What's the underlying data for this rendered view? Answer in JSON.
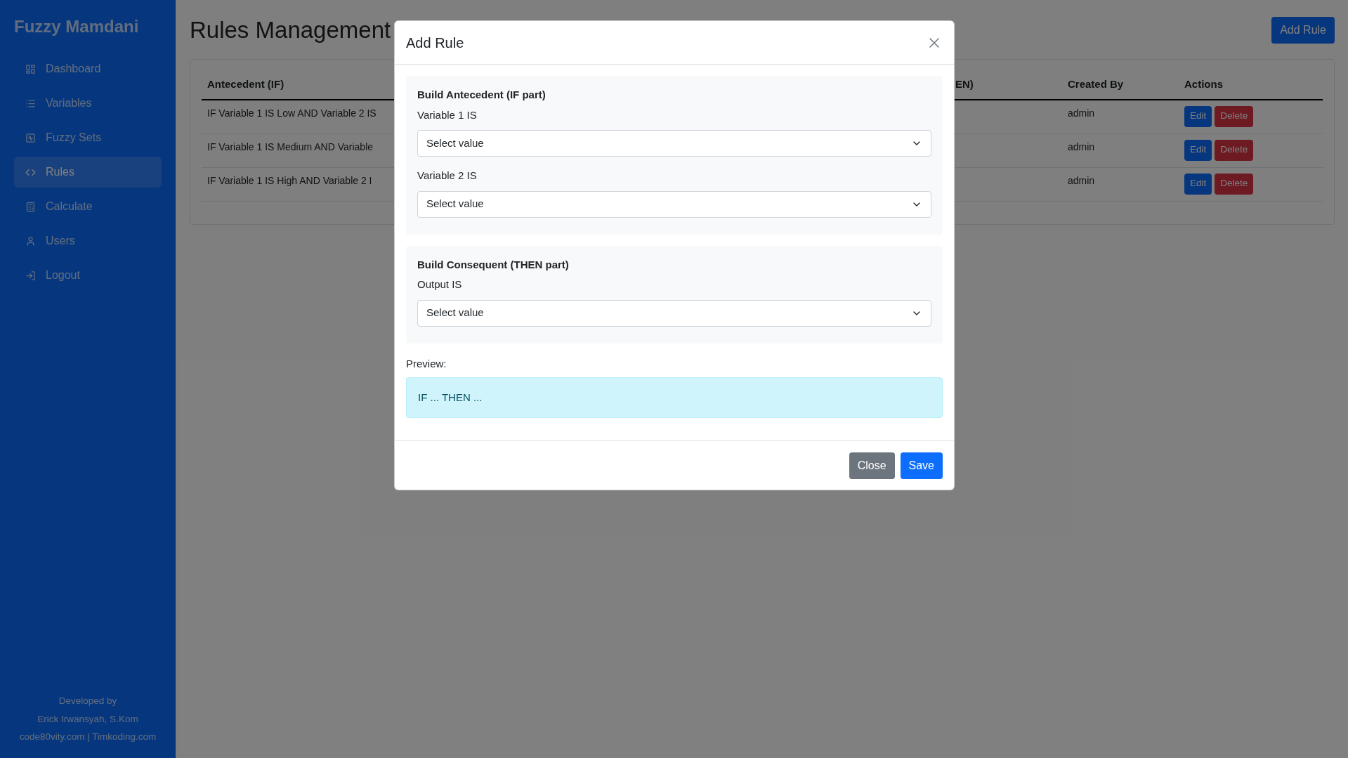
{
  "sidebar": {
    "brand": "Fuzzy Mamdani",
    "items": [
      {
        "label": "Dashboard",
        "selected": false
      },
      {
        "label": "Variables",
        "selected": false
      },
      {
        "label": "Fuzzy Sets",
        "selected": false
      },
      {
        "label": "Rules",
        "selected": true
      },
      {
        "label": "Calculate",
        "selected": false
      },
      {
        "label": "Users",
        "selected": false
      },
      {
        "label": "Logout",
        "selected": false
      }
    ],
    "footer": [
      "Developed by",
      "Erick Irwansyah, S.Kom",
      "code80vity.com | Timkoding.com"
    ]
  },
  "page": {
    "title": "Rules Management",
    "add_button": "Add Rule",
    "table": {
      "columns": [
        "Antecedent (IF)",
        "EN)",
        "Created By",
        "Actions"
      ],
      "rows": [
        {
          "antecedent": "IF Variable 1 IS Low AND Variable 2 IS",
          "created_by": "admin",
          "actions": [
            {
              "label": "Edit",
              "kind": "edit"
            },
            {
              "label": "Delete",
              "kind": "delete"
            }
          ]
        },
        {
          "antecedent": "IF Variable 1 IS Medium AND Variable",
          "created_by": "admin",
          "actions": [
            {
              "label": "Edit",
              "kind": "edit"
            },
            {
              "label": "Delete",
              "kind": "delete"
            }
          ]
        },
        {
          "antecedent": "IF Variable 1 IS High AND Variable 2 I",
          "created_by": "admin",
          "actions": [
            {
              "label": "Edit",
              "kind": "edit"
            },
            {
              "label": "Delete",
              "kind": "delete"
            }
          ]
        }
      ]
    }
  },
  "modal": {
    "title": "Add Rule",
    "sections": [
      {
        "heading": "Build Antecedent (IF part)",
        "fields": [
          {
            "label": "Variable 1 IS",
            "placeholder": "Select value"
          },
          {
            "label": "Variable 2 IS",
            "placeholder": "Select value"
          }
        ]
      },
      {
        "heading": "Build Consequent (THEN part)",
        "fields": [
          {
            "label": "Output IS",
            "placeholder": "Select value"
          }
        ]
      }
    ],
    "preview_label": "Preview:",
    "preview": "IF ... THEN ...",
    "buttons": [
      {
        "label": "Close",
        "kind": "secondary"
      },
      {
        "label": "Save",
        "kind": "primary"
      }
    ]
  }
}
